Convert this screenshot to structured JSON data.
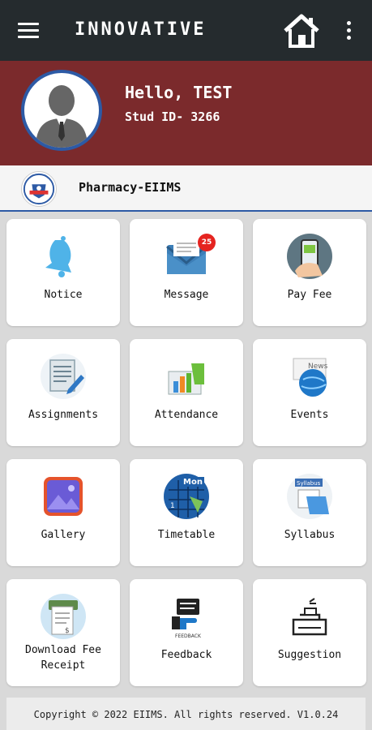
{
  "header": {
    "title": "INNOVATIVE"
  },
  "profile": {
    "greeting": "Hello, TEST",
    "student_id": "Stud ID- 3266"
  },
  "school": {
    "name": "Pharmacy-EIIMS"
  },
  "tiles": [
    {
      "label": "Notice",
      "icon": "bell-icon"
    },
    {
      "label": "Message",
      "icon": "envelope-icon",
      "badge": "25"
    },
    {
      "label": "Pay Fee",
      "icon": "mobile-payment-icon"
    },
    {
      "label": "Assignments",
      "icon": "assignment-pen-icon"
    },
    {
      "label": "Attendance",
      "icon": "attendance-chart-icon"
    },
    {
      "label": "Events",
      "icon": "globe-news-icon"
    },
    {
      "label": "Gallery",
      "icon": "image-gallery-icon"
    },
    {
      "label": "Timetable",
      "icon": "calendar-icon"
    },
    {
      "label": "Syllabus",
      "icon": "syllabus-folder-icon"
    },
    {
      "label": "Download Fee Receipt",
      "icon": "receipt-icon"
    },
    {
      "label": "Feedback",
      "icon": "feedback-icon"
    },
    {
      "label": "Suggestion",
      "icon": "suggestion-box-icon"
    }
  ],
  "icon_text": {
    "calendar_month": "Mon",
    "syllabus_folder": "Syllabus",
    "feedback_caption": "FEEDBACK",
    "news_sign": "News"
  },
  "colors": {
    "topbar": "#252b2e",
    "profile_bg": "#7b2a2c",
    "accent_blue": "#2d5aa5",
    "badge_red": "#e52420"
  },
  "footer": {
    "copyright": "Copyright © 2022 EIIMS. All rights reserved. V1.0.24"
  }
}
